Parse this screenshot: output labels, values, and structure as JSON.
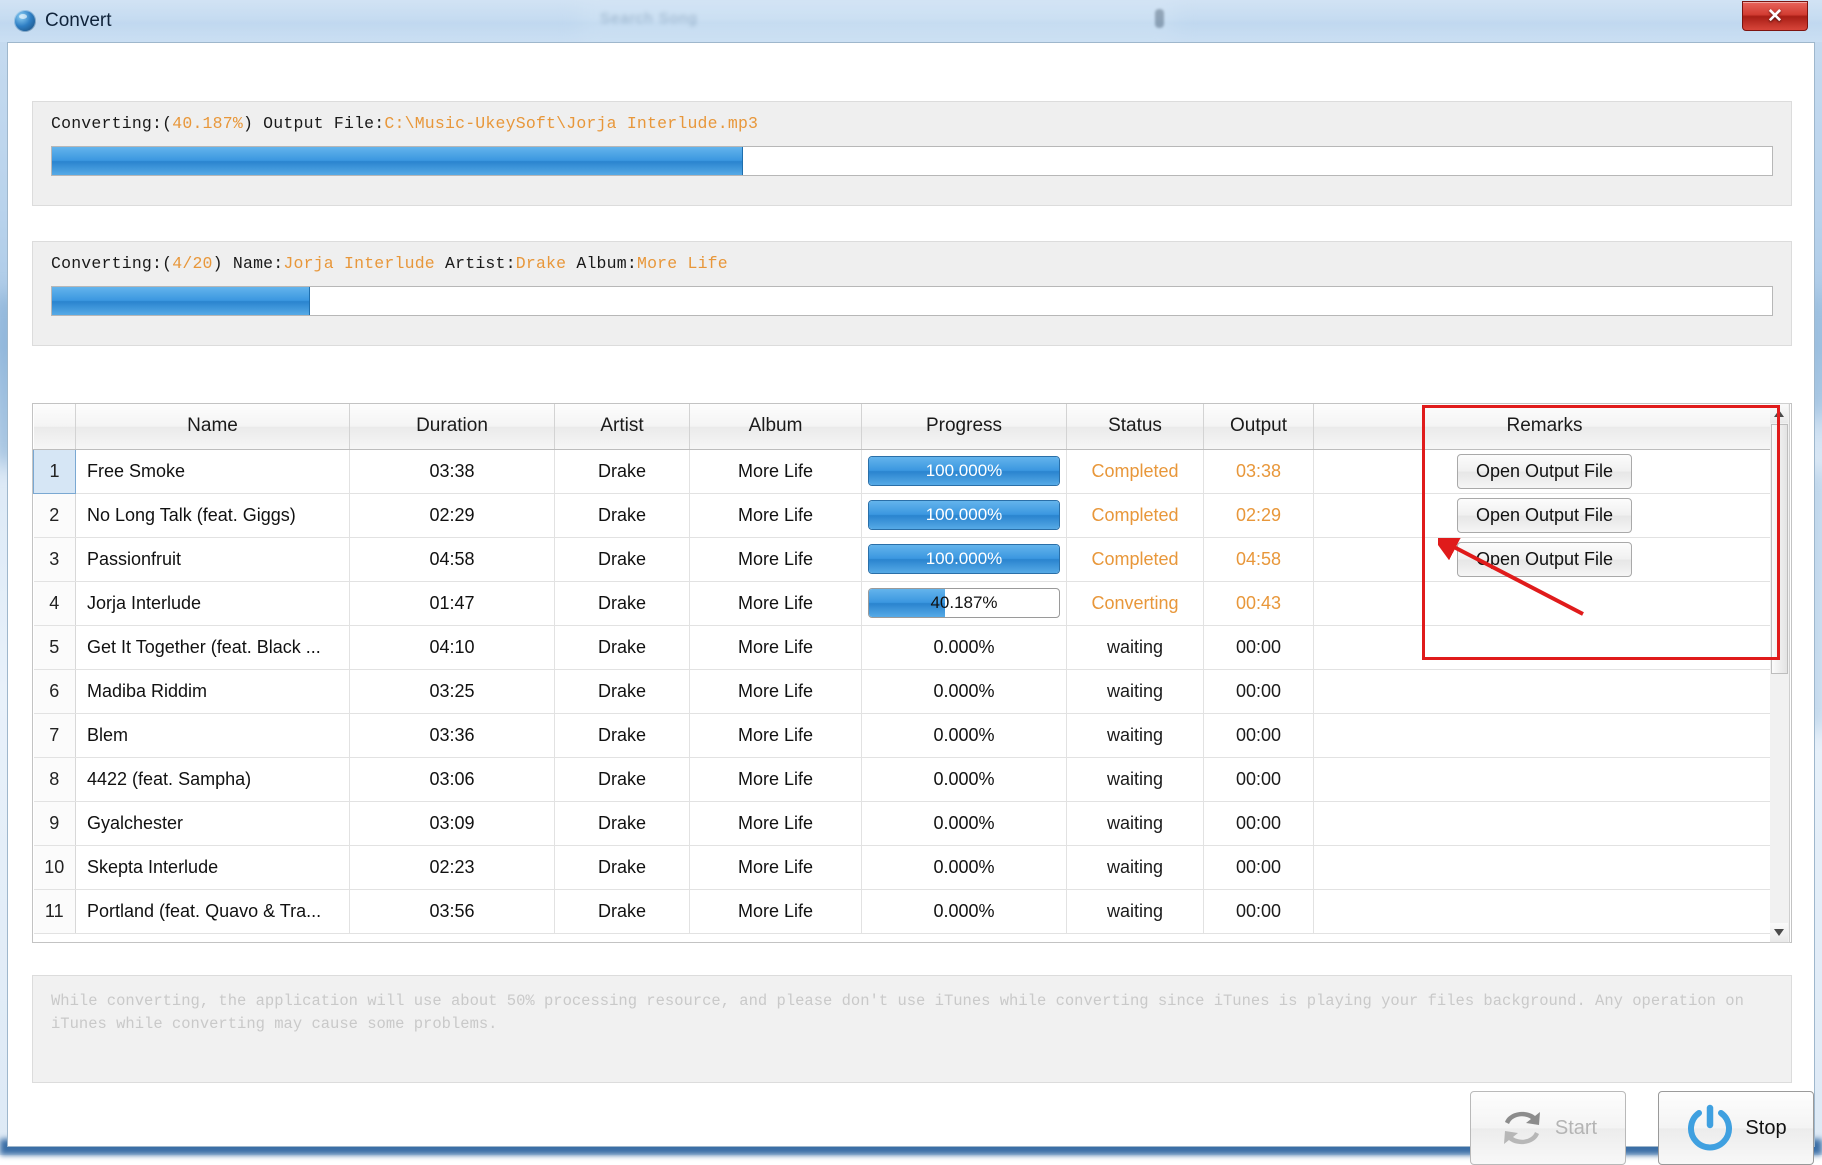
{
  "window": {
    "title": "Convert",
    "app_icon": "app-globe-icon",
    "close_label": "✕"
  },
  "backdrop": {
    "search_placeholder": "Search Song"
  },
  "overall": {
    "prefix": "Converting:(",
    "percent": "40.187%",
    "mid": ") Output File:",
    "output_path": "C:\\Music-UkeySoft\\Jorja Interlude.mp3",
    "fill_percent": 40.187
  },
  "current_file": {
    "prefix": "Converting:(",
    "index": "4/20",
    "name_label": ") Name:",
    "name": "Jorja Interlude",
    "artist_label": " Artist:",
    "artist": "Drake",
    "album_label": " Album:",
    "album": "More Life",
    "fill_percent": 15.0
  },
  "table": {
    "columns": [
      "",
      "Name",
      "Duration",
      "Artist",
      "Album",
      "Progress",
      "Status",
      "Output",
      "Remarks"
    ],
    "rows": [
      {
        "idx": "1",
        "name": "Free Smoke",
        "duration": "03:38",
        "artist": "Drake",
        "album": "More Life",
        "progress": "100.000%",
        "progress_value": 100,
        "status": "Completed",
        "output": "03:38",
        "remark": "Open Output File",
        "selected": true
      },
      {
        "idx": "2",
        "name": "No Long Talk (feat. Giggs)",
        "duration": "02:29",
        "artist": "Drake",
        "album": "More Life",
        "progress": "100.000%",
        "progress_value": 100,
        "status": "Completed",
        "output": "02:29",
        "remark": "Open Output File",
        "selected": false
      },
      {
        "idx": "3",
        "name": "Passionfruit",
        "duration": "04:58",
        "artist": "Drake",
        "album": "More Life",
        "progress": "100.000%",
        "progress_value": 100,
        "status": "Completed",
        "output": "04:58",
        "remark": "Open Output File",
        "selected": false
      },
      {
        "idx": "4",
        "name": "Jorja Interlude",
        "duration": "01:47",
        "artist": "Drake",
        "album": "More Life",
        "progress": "40.187%",
        "progress_value": 40.187,
        "status": "Converting",
        "output": "00:43",
        "remark": "",
        "selected": false
      },
      {
        "idx": "5",
        "name": "Get It Together (feat. Black ...",
        "duration": "04:10",
        "artist": "Drake",
        "album": "More Life",
        "progress": "0.000%",
        "progress_value": 0,
        "status": "waiting",
        "output": "00:00",
        "remark": "",
        "selected": false
      },
      {
        "idx": "6",
        "name": "Madiba Riddim",
        "duration": "03:25",
        "artist": "Drake",
        "album": "More Life",
        "progress": "0.000%",
        "progress_value": 0,
        "status": "waiting",
        "output": "00:00",
        "remark": "",
        "selected": false
      },
      {
        "idx": "7",
        "name": "Blem",
        "duration": "03:36",
        "artist": "Drake",
        "album": "More Life",
        "progress": "0.000%",
        "progress_value": 0,
        "status": "waiting",
        "output": "00:00",
        "remark": "",
        "selected": false
      },
      {
        "idx": "8",
        "name": "4422 (feat. Sampha)",
        "duration": "03:06",
        "artist": "Drake",
        "album": "More Life",
        "progress": "0.000%",
        "progress_value": 0,
        "status": "waiting",
        "output": "00:00",
        "remark": "",
        "selected": false
      },
      {
        "idx": "9",
        "name": "Gyalchester",
        "duration": "03:09",
        "artist": "Drake",
        "album": "More Life",
        "progress": "0.000%",
        "progress_value": 0,
        "status": "waiting",
        "output": "00:00",
        "remark": "",
        "selected": false
      },
      {
        "idx": "10",
        "name": "Skepta Interlude",
        "duration": "02:23",
        "artist": "Drake",
        "album": "More Life",
        "progress": "0.000%",
        "progress_value": 0,
        "status": "waiting",
        "output": "00:00",
        "remark": "",
        "selected": false
      },
      {
        "idx": "11",
        "name": "Portland (feat. Quavo & Tra...",
        "duration": "03:56",
        "artist": "Drake",
        "album": "More Life",
        "progress": "0.000%",
        "progress_value": 0,
        "status": "waiting",
        "output": "00:00",
        "remark": "",
        "selected": false
      }
    ]
  },
  "notice": {
    "text": "While converting, the application will use about 50% processing resource, and please don't use iTunes while converting since iTunes is playing your files background. Any operation on iTunes while converting may cause some problems."
  },
  "footer": {
    "start_label": "Start",
    "stop_label": "Stop"
  },
  "colors": {
    "accent_orange": "#e8973a",
    "progress_blue": "#3b97e0",
    "annotation_red": "#e01b1b"
  }
}
